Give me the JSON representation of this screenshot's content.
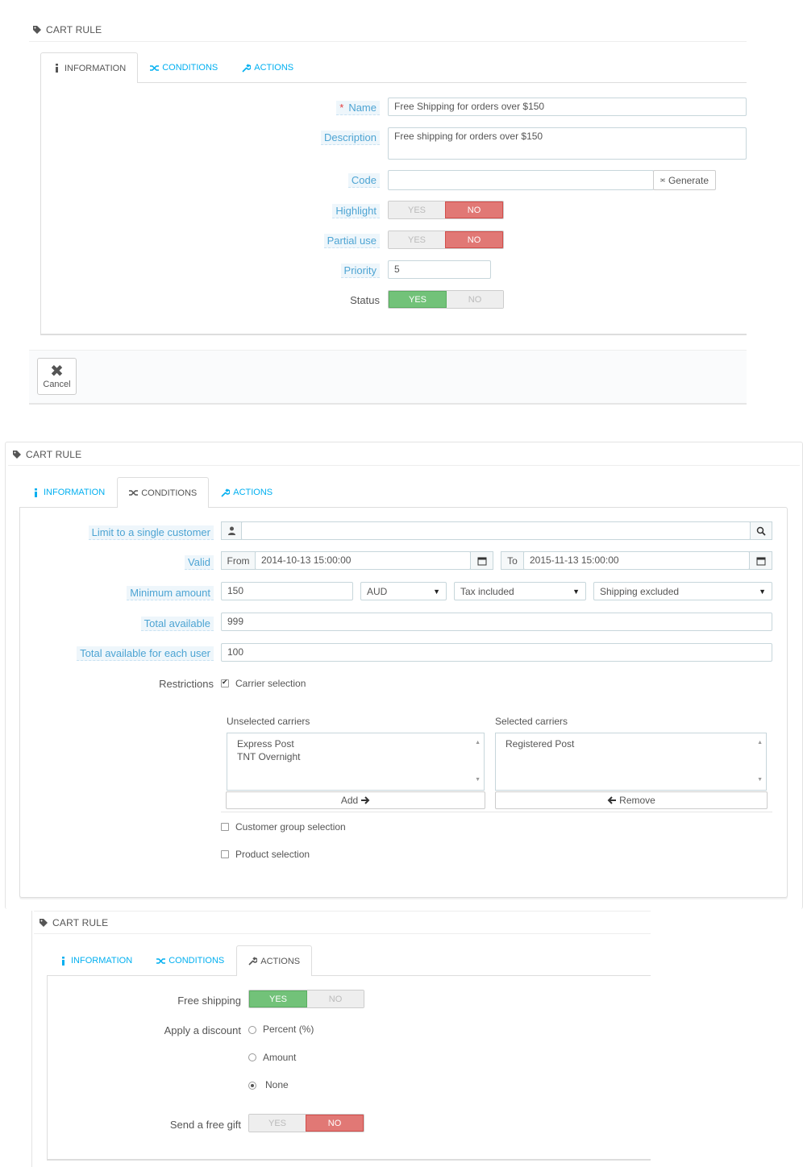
{
  "panel1": {
    "heading": "CART RULE",
    "tabs": [
      {
        "label": "INFORMATION",
        "icon": "info-icon"
      },
      {
        "label": "CONDITIONS",
        "icon": "random-icon"
      },
      {
        "label": "ACTIONS",
        "icon": "wrench-icon"
      }
    ],
    "name_label": "Name",
    "name_value": "Free Shipping for orders over $150",
    "description_label": "Description",
    "description_value": "Free shipping for orders over $150",
    "code_label": "Code",
    "code_value": "",
    "generate_label": "Generate",
    "highlight_label": "Highlight",
    "partial_use_label": "Partial use",
    "priority_label": "Priority",
    "priority_value": "5",
    "status_label": "Status",
    "yes": "YES",
    "no": "NO",
    "cancel_label": "Cancel"
  },
  "panel2": {
    "heading": "CART RULE",
    "tabs": [
      {
        "label": "INFORMATION",
        "icon": "info-icon"
      },
      {
        "label": "CONDITIONS",
        "icon": "random-icon"
      },
      {
        "label": "ACTIONS",
        "icon": "wrench-icon"
      }
    ],
    "limit_label": "Limit to a single customer",
    "limit_value": "",
    "valid_label": "Valid",
    "from_label": "From",
    "from_value": "2014-10-13 15:00:00",
    "to_label": "To",
    "to_value": "2015-11-13 15:00:00",
    "min_amount_label": "Minimum amount",
    "min_amount_value": "150",
    "currency": "AUD",
    "tax": "Tax included",
    "shipping": "Shipping excluded",
    "total_available_label": "Total available",
    "total_available_value": "999",
    "total_each_label": "Total available for each user",
    "total_each_value": "100",
    "restrictions_label": "Restrictions",
    "carrier_selection_label": "Carrier selection",
    "unselected_label": "Unselected carriers",
    "unselected_items": [
      "Express Post",
      "TNT Overnight"
    ],
    "selected_label": "Selected carriers",
    "selected_items": [
      "Registered Post"
    ],
    "add_label": "Add",
    "remove_label": "Remove",
    "customer_group_label": "Customer group selection",
    "product_selection_label": "Product selection"
  },
  "panel3": {
    "heading": "CART RULE",
    "tabs": [
      {
        "label": "INFORMATION",
        "icon": "info-icon"
      },
      {
        "label": "CONDITIONS",
        "icon": "random-icon"
      },
      {
        "label": "ACTIONS",
        "icon": "wrench-icon"
      }
    ],
    "free_shipping_label": "Free shipping",
    "apply_discount_label": "Apply a discount",
    "percent_label": "Percent (%)",
    "amount_label": "Amount",
    "none_label": "None",
    "free_gift_label": "Send a free gift",
    "yes": "YES",
    "no": "NO"
  }
}
